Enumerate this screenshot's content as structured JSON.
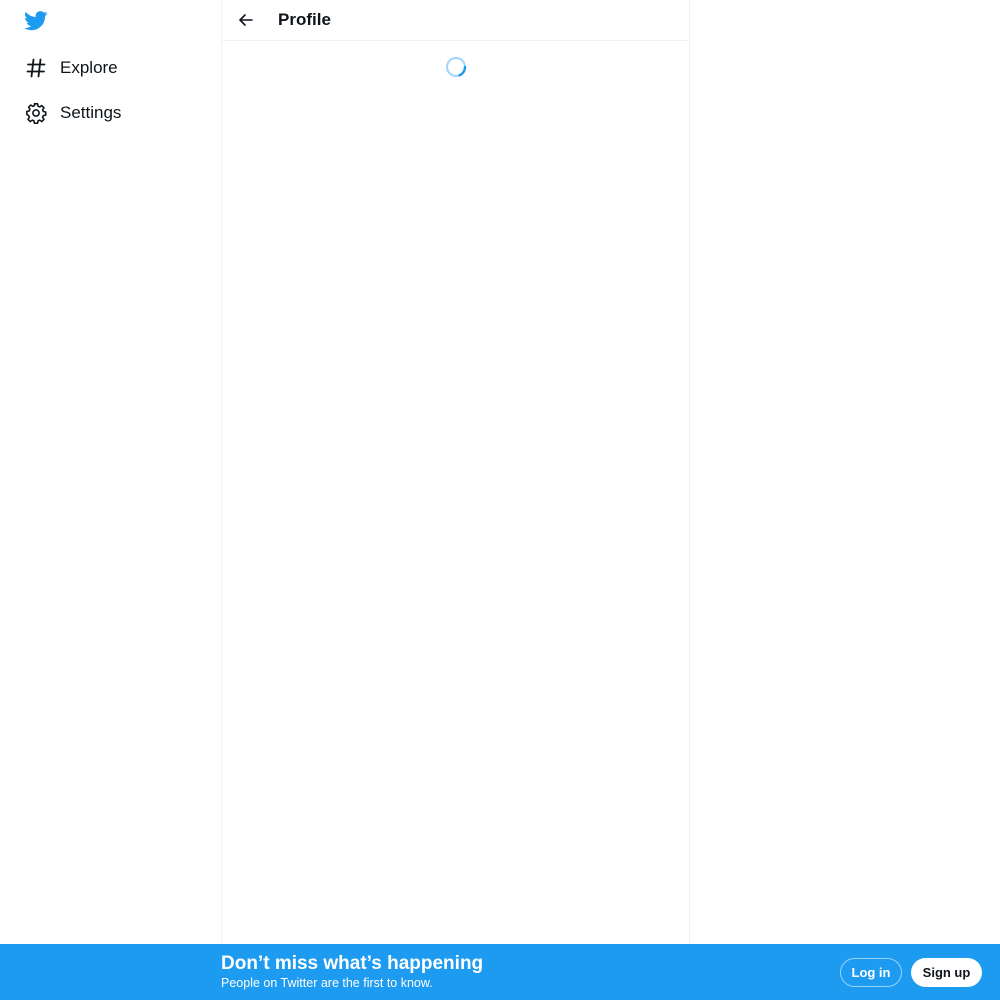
{
  "nav": {
    "logo_icon": "twitter-bird-icon",
    "items": [
      {
        "label": "Explore",
        "icon": "hashtag-icon"
      },
      {
        "label": "Settings",
        "icon": "gear-icon"
      }
    ]
  },
  "header": {
    "back_icon": "arrow-left-icon",
    "title": "Profile"
  },
  "content": {
    "loading_icon": "loading-spinner-icon"
  },
  "banner": {
    "title": "Don’t miss what’s happening",
    "subtitle": "People on Twitter are the first to know.",
    "login_label": "Log in",
    "signup_label": "Sign up"
  },
  "colors": {
    "brand": "#1d9bf0",
    "text": "#0f1419",
    "border": "#eff3f4",
    "background": "#ffffff"
  }
}
